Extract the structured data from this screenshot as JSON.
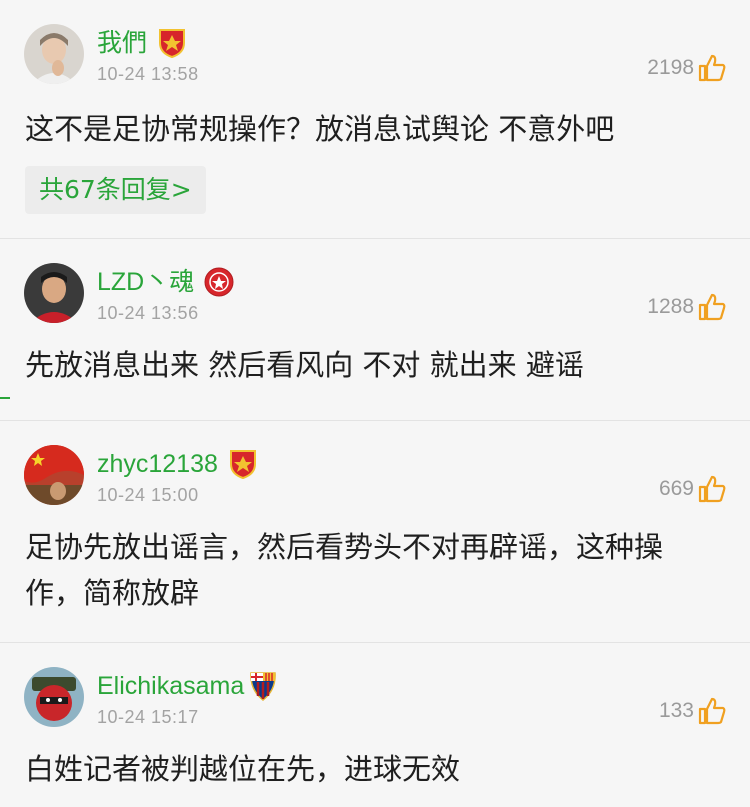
{
  "comments": [
    {
      "username": "我們",
      "badge": "guangzhou-club-badge-icon",
      "time": "10-24 13:58",
      "likes": "2198",
      "text": "这不是足协常规操作？放消息试舆论 不意外吧",
      "replies_label": "共67条回复>"
    },
    {
      "username": "LZD丶魂",
      "badge": "red-club-crest-icon",
      "time": "10-24 13:56",
      "likes": "1288",
      "text": "先放消息出来 然后看风向 不对 就出来 避谣"
    },
    {
      "username": "zhyc12138",
      "badge": "guangzhou-club-badge-icon",
      "time": "10-24 15:00",
      "likes": "669",
      "text": "足协先放出谣言，然后看势头不对再辟谣，这种操作，简称放辟"
    },
    {
      "username": "Elichikasama",
      "badge": "barcelona-crest-icon",
      "time": "10-24 15:17",
      "likes": "133",
      "text": "白姓记者被判越位在先，进球无效"
    }
  ],
  "colors": {
    "accent": "#2aa53a",
    "like_icon": "#f0a020",
    "background": "#f6f6f6"
  }
}
